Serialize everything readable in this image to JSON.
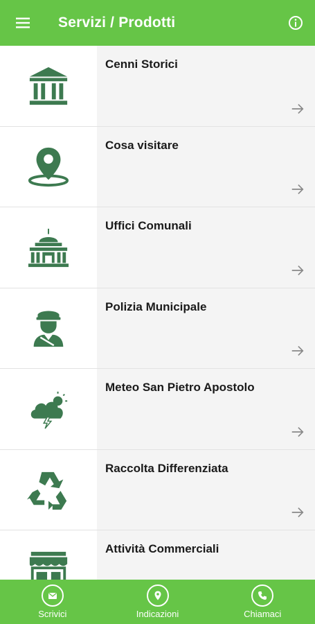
{
  "colors": {
    "accent": "#66c547",
    "icon": "#3d7a50",
    "row_text_bg": "#f4f4f4"
  },
  "header": {
    "title": "Servizi / Prodotti",
    "menu_icon": "hamburger-menu-icon",
    "info_icon": "info-icon"
  },
  "items": [
    {
      "title": "Cenni Storici",
      "icon": "museum-building-icon"
    },
    {
      "title": "Cosa visitare",
      "icon": "map-pin-icon"
    },
    {
      "title": "Uffici Comunali",
      "icon": "town-hall-icon"
    },
    {
      "title": "Polizia Municipale",
      "icon": "police-officer-icon"
    },
    {
      "title": "Meteo San Pietro Apostolo",
      "icon": "storm-cloud-icon"
    },
    {
      "title": "Raccolta Differenziata",
      "icon": "recycle-icon"
    },
    {
      "title": "Attività Commerciali",
      "icon": "shop-icon"
    }
  ],
  "bottom_nav": [
    {
      "label": "Scrivici",
      "icon": "mail-icon"
    },
    {
      "label": "Indicazioni",
      "icon": "location-icon"
    },
    {
      "label": "Chiamaci",
      "icon": "phone-icon"
    }
  ]
}
